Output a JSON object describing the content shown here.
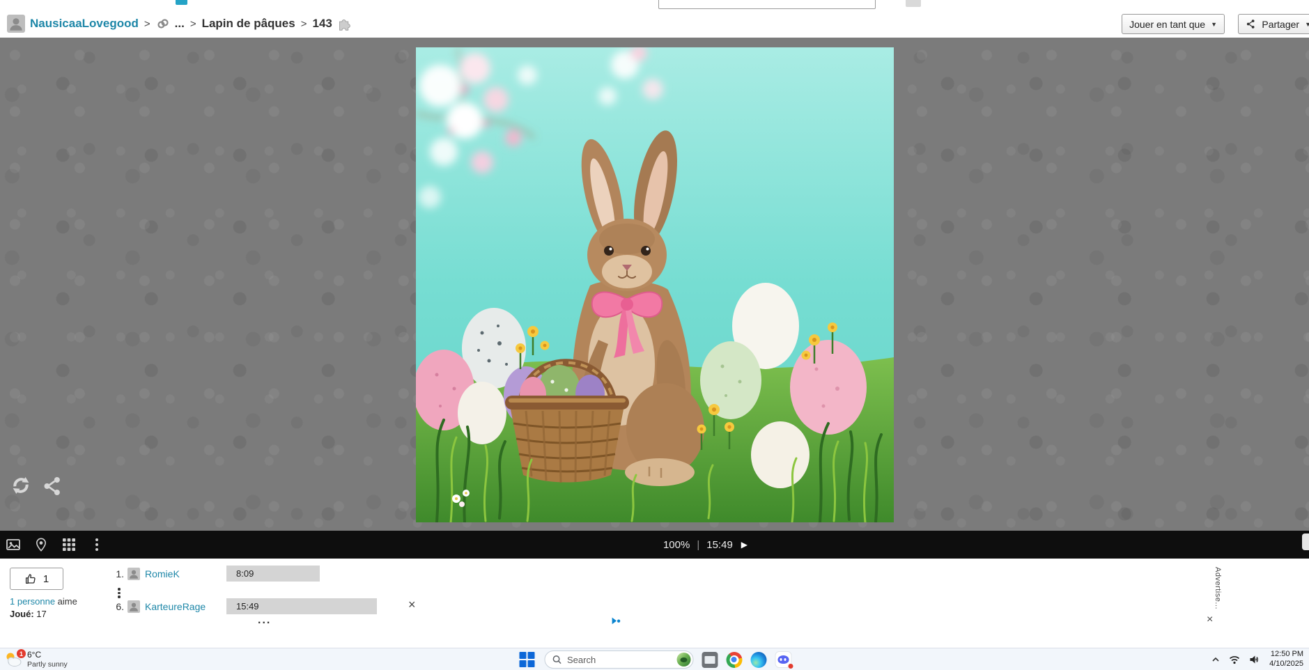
{
  "breadcrumb": {
    "user": "NausicaaLovegood",
    "separator": ">",
    "ellipsis": "...",
    "puzzle_name": "Lapin de pâques",
    "piece_count": "143"
  },
  "actions": {
    "play_as_label": "Jouer en tant que",
    "share_label": "Partager",
    "caret": "▼"
  },
  "player_bar": {
    "zoom": "100%",
    "divider": "|",
    "time": "15:49",
    "play_glyph": "▶"
  },
  "social": {
    "like_count": "1",
    "likers_link": "1 personne",
    "likers_suffix": " aime",
    "played_label": "Joué:",
    "played_count": " 17"
  },
  "leaderboard": {
    "rows": [
      {
        "rank": "1.",
        "name": "RomieK",
        "time": "8:09"
      },
      {
        "rank": "6.",
        "name": "KarteureRage",
        "time": "15:49"
      }
    ],
    "more": "...",
    "close_glyph": "×"
  },
  "ad": {
    "label": "Advertise...",
    "close_glyph": "×"
  },
  "taskbar": {
    "weather": {
      "temp": "6°C",
      "condition": "Partly sunny",
      "badge": "1"
    },
    "search_placeholder": "Search",
    "clock": {
      "time": "12:50 PM",
      "date": "4/10/2025"
    }
  }
}
